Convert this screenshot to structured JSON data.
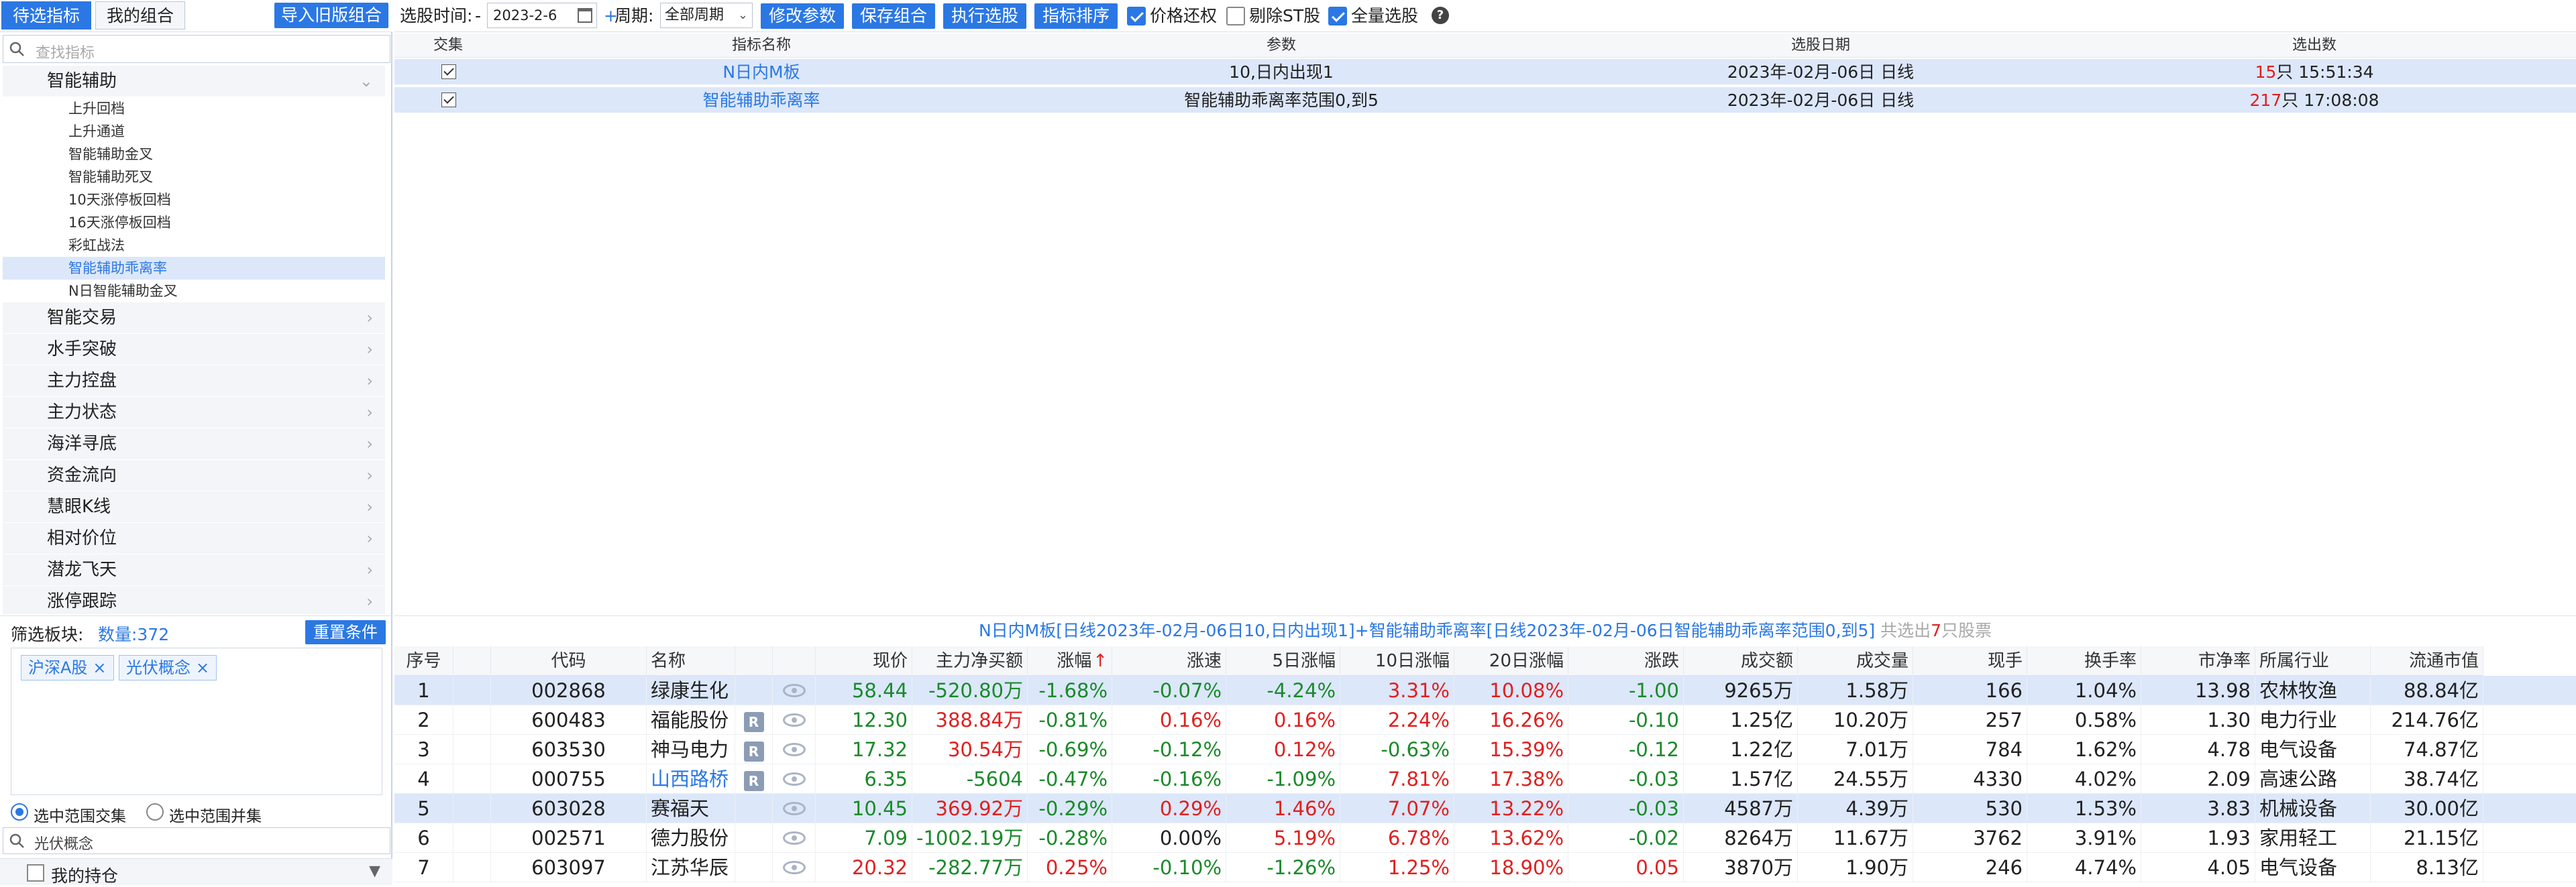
{
  "left_panel": {
    "tabs": [
      "待选指标",
      "我的组合"
    ],
    "import_button": "导入旧版组合",
    "search_placeholder": "查找指标",
    "categories": [
      {
        "label": "智能辅助",
        "expanded": true,
        "children": [
          "上升回档",
          "上升通道",
          "智能辅助金叉",
          "智能辅助死叉",
          "10天涨停板回档",
          "16天涨停板回档",
          "彩虹战法",
          "智能辅助乖离率",
          "N日智能辅助金叉"
        ],
        "selected_child": 7
      },
      {
        "label": "智能交易"
      },
      {
        "label": "水手突破"
      },
      {
        "label": "主力控盘"
      },
      {
        "label": "主力状态"
      },
      {
        "label": "海洋寻底"
      },
      {
        "label": "资金流向"
      },
      {
        "label": "慧眼K线"
      },
      {
        "label": "相对价位"
      },
      {
        "label": "潜龙飞天"
      },
      {
        "label": "涨停跟踪"
      }
    ],
    "filter_label": "筛选板块:",
    "filter_count": "数量:372",
    "reset_button": "重置条件",
    "tags": [
      "沪深A股",
      "光伏概念"
    ],
    "tag_close": "×",
    "scope_options": [
      "选中范围交集",
      "选中范围并集"
    ],
    "scope_selected": 0,
    "concept_search": "光伏概念",
    "holdings_label": "我的持仓"
  },
  "toolbar": {
    "date_label": "选股时间:",
    "date_dash": "-",
    "date_value": "2023-2-6",
    "period_plus": "+",
    "period_label": "周期:",
    "period_value": "全部周期",
    "buttons": [
      "修改参数",
      "保存组合",
      "执行选股",
      "指标排序"
    ],
    "checkboxes": [
      {
        "label": "价格还权",
        "checked": true
      },
      {
        "label": "剔除ST股",
        "checked": false
      },
      {
        "label": "全量选股",
        "checked": true
      }
    ],
    "help": "?"
  },
  "indicator_table": {
    "headers": [
      "交集",
      "指标名称",
      "参数",
      "选股日期",
      "选出数"
    ],
    "rows": [
      {
        "checked": true,
        "name": "N日内M板",
        "params": "10,日内出现1",
        "date": "2023年-02月-06日 日线",
        "count": "15",
        "count_suffix": "只 15:51:34"
      },
      {
        "checked": true,
        "name": "智能辅助乖离率",
        "params": "智能辅助乖离率范围0,到5",
        "date": "2023年-02月-06日 日线",
        "count": "217",
        "count_suffix": "只 17:08:08"
      }
    ]
  },
  "summary": {
    "condition": "N日内M板[日线2023年-02月-06日10,日内出现1]+智能辅助乖离率[日线2023年-02月-06日智能辅助乖离率范围0,到5]",
    "prefix": "共选出",
    "count": "7",
    "suffix": "只股票"
  },
  "result_table": {
    "headers": [
      "序号",
      "代码",
      "名称",
      "现价",
      "主力净买额",
      "涨幅",
      "涨速",
      "5日涨幅",
      "10日涨幅",
      "20日涨幅",
      "涨跌",
      "成交额",
      "成交量",
      "现手",
      "换手率",
      "市净率",
      "所属行业",
      "流通市值"
    ],
    "sort_marker": "↑",
    "rows": [
      {
        "no": "1",
        "code": "002868",
        "name": "绿康生化",
        "badge": "",
        "price": "58.44",
        "net_buy": "-520.80万",
        "chg": "-1.68%",
        "speed": "-0.07%",
        "d5": "-4.24%",
        "d10": "3.31%",
        "d20": "10.08%",
        "diff": "-1.00",
        "amount": "9265万",
        "volume": "1.58万",
        "hand": "166",
        "turnover": "1.04%",
        "pb": "13.98",
        "industry": "农林牧渔",
        "mcap": "88.84亿"
      },
      {
        "no": "2",
        "code": "600483",
        "name": "福能股份",
        "badge": "R",
        "price": "12.30",
        "net_buy": "388.84万",
        "chg": "-0.81%",
        "speed": "0.16%",
        "d5": "0.16%",
        "d10": "2.24%",
        "d20": "16.26%",
        "diff": "-0.10",
        "amount": "1.25亿",
        "volume": "10.20万",
        "hand": "257",
        "turnover": "0.58%",
        "pb": "1.30",
        "industry": "电力行业",
        "mcap": "214.76亿"
      },
      {
        "no": "3",
        "code": "603530",
        "name": "神马电力",
        "badge": "R",
        "price": "17.32",
        "net_buy": "30.54万",
        "chg": "-0.69%",
        "speed": "-0.12%",
        "d5": "0.12%",
        "d10": "-0.63%",
        "d20": "15.39%",
        "diff": "-0.12",
        "amount": "1.22亿",
        "volume": "7.01万",
        "hand": "784",
        "turnover": "1.62%",
        "pb": "4.78",
        "industry": "电气设备",
        "mcap": "74.87亿"
      },
      {
        "no": "4",
        "code": "000755",
        "name": "山西路桥",
        "badge": "R",
        "price": "6.35",
        "net_buy": "-5604",
        "chg": "-0.47%",
        "speed": "-0.16%",
        "d5": "-1.09%",
        "d10": "7.81%",
        "d20": "17.38%",
        "diff": "-0.03",
        "amount": "1.57亿",
        "volume": "24.55万",
        "hand": "4330",
        "turnover": "4.02%",
        "pb": "2.09",
        "industry": "高速公路",
        "mcap": "38.74亿"
      },
      {
        "no": "5",
        "code": "603028",
        "name": "赛福天",
        "badge": "",
        "price": "10.45",
        "net_buy": "369.92万",
        "chg": "-0.29%",
        "speed": "0.29%",
        "d5": "1.46%",
        "d10": "7.07%",
        "d20": "13.22%",
        "diff": "-0.03",
        "amount": "4587万",
        "volume": "4.39万",
        "hand": "530",
        "turnover": "1.53%",
        "pb": "3.83",
        "industry": "机械设备",
        "mcap": "30.00亿"
      },
      {
        "no": "6",
        "code": "002571",
        "name": "德力股份",
        "badge": "",
        "price": "7.09",
        "net_buy": "-1002.19万",
        "chg": "-0.28%",
        "speed": "0.00%",
        "d5": "5.19%",
        "d10": "6.78%",
        "d20": "13.62%",
        "diff": "-0.02",
        "amount": "8264万",
        "volume": "11.67万",
        "hand": "3762",
        "turnover": "3.91%",
        "pb": "1.93",
        "industry": "家用轻工",
        "mcap": "21.15亿"
      },
      {
        "no": "7",
        "code": "603097",
        "name": "江苏华辰",
        "badge": "",
        "price": "20.32",
        "net_buy": "-282.77万",
        "chg": "0.25%",
        "speed": "-0.10%",
        "d5": "-1.26%",
        "d10": "1.25%",
        "d20": "18.90%",
        "diff": "0.05",
        "amount": "3870万",
        "volume": "1.90万",
        "hand": "246",
        "turnover": "4.74%",
        "pb": "4.05",
        "industry": "电气设备",
        "mcap": "8.13亿"
      }
    ],
    "highlight_rows": [
      0,
      4
    ],
    "blue_name_row": 3
  }
}
